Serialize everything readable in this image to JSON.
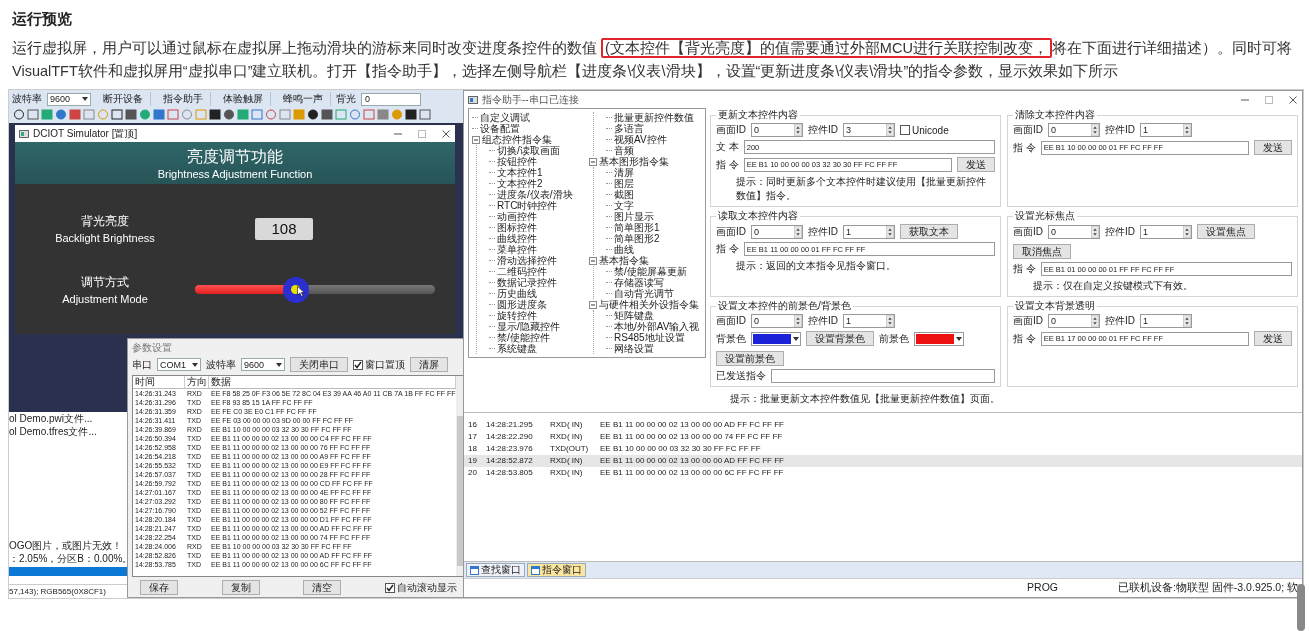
{
  "article": {
    "heading": "运行预览",
    "paragraph_parts": [
      {
        "text": "运行虚拟屏，用户可以通过鼠标在虚拟屏上拖动滑块的游标来同时改变进度条控件的数值 ",
        "highlighted": false
      },
      {
        "text": "(文本控件【背光亮度】的值需要通过外部MCU进行关联控制改变，",
        "highlighted": true
      },
      {
        "text": "将在下面进行详细描述）。同时可将VisualTFT软件和虚拟屏用“虚拟串口”建立联机。打开【指令助手】，选择左侧导航栏【进度条\\仪表\\滑块】，设置“更新进度条\\仪表\\滑块”的指令参数，显示效果如下所示",
        "highlighted": false
      }
    ]
  },
  "screenshot": {
    "toolbar": {
      "baud_label": "波特率",
      "baud_value": "9600",
      "buttons": [
        "断开设备",
        "指令助手",
        "体验触屏",
        "蜂鸣一声"
      ],
      "backlight_label": "背光",
      "backlight_value": "0"
    },
    "simulator": {
      "title": "DCIOT Simulator [置顶]",
      "heading": "亮度调节功能",
      "subheading": "Brightness Adjustment Function",
      "backlight": {
        "label_cn": "背光亮度",
        "label_en": "Backlight Brightness",
        "value": "108"
      },
      "adjust": {
        "label_cn": "调节方式",
        "label_en": "Adjustment Mode",
        "level": 0.42
      }
    },
    "background_window": {
      "lines": [
        "ol Demo.pwi文件...",
        "ol Demo.tfres文件..."
      ],
      "messages": [
        "OGO图片，或图片无效！",
        "：2.05%，分区B：0.00%。"
      ],
      "status": "57,143); RGB565(0X8CF1)"
    },
    "param_window": {
      "title": "参数设置",
      "port_label": "串口",
      "port": "COM1",
      "baud_label": "波特率",
      "baud": "9600",
      "close_button": "关闭串口",
      "topmost": {
        "label": "窗口置顶",
        "checked": true
      },
      "clear_button": "清屏",
      "columns": [
        "时间",
        "方向",
        "数据"
      ],
      "rows": [
        [
          "14:26:31.243",
          "RXD",
          "EE F8 58 25 0F F3 06 5E 72 8C 04 E3 39 AA 46 A0 11 CB 7A 1B FF FC FF FF"
        ],
        [
          "14:26:31.296",
          "TXD",
          "EE F8 93 85 15 1A FF FC FF FF"
        ],
        [
          "14:26:31.359",
          "RXD",
          "EE FE C0 3E E0 C1 FF FC FF FF"
        ],
        [
          "14:26:31.411",
          "TXD",
          "EE FE 03 00 00 00 03 9D 00 00 FF FC FF FF"
        ],
        [
          "14:26:39.869",
          "RXD",
          "EE B1 10 00 00 00 03 32 30 30 FF FC FF FF"
        ],
        [
          "14:26:50.394",
          "TXD",
          "EE B1 11 00 00 00 02 13 00 00 00 C4 FF FC FF FF"
        ],
        [
          "14:26:52.958",
          "TXD",
          "EE B1 11 00 00 00 02 13 00 00 00 76 FF FC FF FF"
        ],
        [
          "14:26:54.218",
          "TXD",
          "EE B1 11 00 00 00 02 13 00 00 00 A9 FF FC FF FF"
        ],
        [
          "14:26:55.532",
          "TXD",
          "EE B1 11 00 00 00 02 13 00 00 00 E9 FF FC FF FF"
        ],
        [
          "14:26:57.037",
          "TXD",
          "EE B1 11 00 00 00 02 13 00 00 00 28 FF FC FF FF"
        ],
        [
          "14:26:59.792",
          "TXD",
          "EE B1 11 00 00 00 02 13 00 00 00 CD FF FC FF FF"
        ],
        [
          "14:27:01.167",
          "TXD",
          "EE B1 11 00 00 00 02 13 00 00 00 4E FF FC FF FF"
        ],
        [
          "14:27:03.292",
          "TXD",
          "EE B1 11 00 00 00 02 13 00 00 00 80 FF FC FF FF"
        ],
        [
          "14:27:16.790",
          "TXD",
          "EE B1 11 00 00 00 02 13 00 00 00 52 FF FC FF FF"
        ],
        [
          "14:28:20.184",
          "TXD",
          "EE B1 11 00 00 00 02 13 00 00 00 D1 FF FC FF FF"
        ],
        [
          "14:28:21.247",
          "TXD",
          "EE B1 11 00 00 00 02 13 00 00 00 AD FF FC FF FF"
        ],
        [
          "14:28:22.254",
          "TXD",
          "EE B1 11 00 00 00 02 13 00 00 00 74 FF FC FF FF"
        ],
        [
          "14:28:24.006",
          "RXD",
          "EE B1 10 00 00 00 03 32 30 30 FF FC FF FF"
        ],
        [
          "14:28:52.826",
          "TXD",
          "EE B1 11 00 00 00 02 13 00 00 00 AD FF FC FF FF"
        ],
        [
          "14:28:53.785",
          "TXD",
          "EE B1 11 00 00 00 02 13 00 00 00 6C FF FC FF FF"
        ]
      ],
      "bottom_buttons": [
        "保存",
        "复制",
        "清空"
      ],
      "autoscroll": {
        "label": "自动滚动显示",
        "checked": true
      }
    },
    "assistant": {
      "title": "指令助手--串口已连接",
      "tree": [
        {
          "label": "自定义调试"
        },
        {
          "label": "设备配置"
        },
        {
          "label": "组态控件指令集",
          "expanded": true,
          "children": [
            {
              "label": "切换/读取画面"
            },
            {
              "label": "按钮控件"
            },
            {
              "label": "文本控件1"
            },
            {
              "label": "文本控件2"
            },
            {
              "label": "进度条/仪表/滑块"
            },
            {
              "label": "RTC时钟控件"
            },
            {
              "label": "动画控件"
            },
            {
              "label": "图标控件"
            },
            {
              "label": "曲线控件"
            },
            {
              "label": "菜单控件"
            },
            {
              "label": "滑动选择控件"
            },
            {
              "label": "二维码控件"
            },
            {
              "label": "数据记录控件"
            },
            {
              "label": "历史曲线"
            },
            {
              "label": "圆形进度条"
            },
            {
              "label": "旋转控件"
            },
            {
              "label": "显示/隐藏控件"
            },
            {
              "label": "禁/使能控件"
            },
            {
              "label": "系统键盘"
            },
            {
              "label": "批量更新控件数值"
            },
            {
              "label": "多语言"
            },
            {
              "label": "视频AV控件"
            },
            {
              "label": "音频"
            }
          ]
        },
        {
          "label": "基本图形指令集",
          "expanded": true,
          "children": [
            {
              "label": "清屏"
            },
            {
              "label": "图层"
            },
            {
              "label": "截图"
            },
            {
              "label": "文字"
            },
            {
              "label": "图片显示"
            },
            {
              "label": "简单图形1"
            },
            {
              "label": "简单图形2"
            },
            {
              "label": "曲线"
            }
          ]
        },
        {
          "label": "基本指令集",
          "expanded": true,
          "children": [
            {
              "label": "禁/使能屏幕更新"
            },
            {
              "label": "存储器读写"
            },
            {
              "label": "自动背光调节"
            }
          ]
        },
        {
          "label": "与硬件相关外设指令集",
          "expanded": true,
          "children": [
            {
              "label": "矩阵键盘"
            },
            {
              "label": "本地/外部AV输入视"
            },
            {
              "label": "RS485地址设置"
            },
            {
              "label": "网络设置"
            }
          ]
        }
      ],
      "groups": [
        {
          "title": "更新文本控件内容",
          "lines": [
            {
              "items": [
                {
                  "kind": "spin",
                  "label": "画面ID",
                  "value": "0"
                },
                {
                  "kind": "spin",
                  "label": "控件ID",
                  "value": "3"
                },
                {
                  "kind": "checkbox",
                  "label": "Unicode",
                  "checked": false
                }
              ]
            },
            {
              "items": [
                {
                  "kind": "field",
                  "label": "文 本",
                  "value": "200"
                }
              ]
            },
            {
              "items": [
                {
                  "kind": "field",
                  "label": "指 令",
                  "value": "EE B1 10 00 00 00 03 32 30 30 FF FC FF FF"
                },
                {
                  "kind": "button",
                  "label": "发送"
                }
              ]
            },
            {
              "items": [
                {
                  "kind": "hint",
                  "text": "提示：同时更新多个文本控件时建议使用【批量更新控件数值】指令。"
                }
              ]
            }
          ]
        },
        {
          "title": "清除文本控件内容",
          "lines": [
            {
              "items": [
                {
                  "kind": "spin",
                  "label": "画面ID",
                  "value": "0"
                },
                {
                  "kind": "spin",
                  "label": "控件ID",
                  "value": "1"
                }
              ]
            },
            {
              "items": [
                {
                  "kind": "field",
                  "label": "指 令",
                  "value": "EE B1 10 00 00 00 01 FF FC FF FF"
                },
                {
                  "kind": "button",
                  "label": "发送"
                }
              ]
            }
          ]
        },
        {
          "title": "读取文本控件内容",
          "lines": [
            {
              "items": [
                {
                  "kind": "spin",
                  "label": "画面ID",
                  "value": "0"
                },
                {
                  "kind": "spin",
                  "label": "控件ID",
                  "value": "1"
                },
                {
                  "kind": "button",
                  "label": "获取文本"
                }
              ]
            },
            {
              "items": [
                {
                  "kind": "field",
                  "label": "指 令",
                  "value": "EE B1 11 00 00 00 01 FF FC FF FF"
                }
              ]
            },
            {
              "items": [
                {
                  "kind": "hint",
                  "text": "提示：返回的文本指令见指令窗口。"
                }
              ]
            }
          ]
        },
        {
          "title": "设置光标焦点",
          "lines": [
            {
              "items": [
                {
                  "kind": "spin",
                  "label": "画面ID",
                  "value": "0"
                },
                {
                  "kind": "spin",
                  "label": "控件ID",
                  "value": "1"
                },
                {
                  "kind": "button",
                  "label": "设置焦点"
                },
                {
                  "kind": "button",
                  "label": "取消焦点"
                }
              ]
            },
            {
              "items": [
                {
                  "kind": "field",
                  "label": "指 令",
                  "value": "EE B1 01 00 00 00 01 FF FF FC FF FF"
                }
              ]
            },
            {
              "items": [
                {
                  "kind": "hint",
                  "text": "提示：仅在自定义按键模式下有效。"
                }
              ]
            }
          ]
        },
        {
          "title": "设置文本控件的前景色/背景色",
          "lines": [
            {
              "items": [
                {
                  "kind": "spin",
                  "label": "画面ID",
                  "value": "0"
                },
                {
                  "kind": "spin",
                  "label": "控件ID",
                  "value": "1"
                }
              ]
            },
            {
              "items": [
                {
                  "kind": "color",
                  "label": "背景色",
                  "color": "#1c22d8"
                },
                {
                  "kind": "button",
                  "label": "设置背景色"
                },
                {
                  "kind": "color",
                  "label": "前景色",
                  "color": "#ee1111"
                },
                {
                  "kind": "button",
                  "label": "设置前景色"
                }
              ]
            },
            {
              "items": [
                {
                  "kind": "field",
                  "label": "已发送指令"
                }
              ]
            }
          ]
        },
        {
          "title": "设置文本背景透明",
          "lines": [
            {
              "items": [
                {
                  "kind": "spin",
                  "label": "画面ID",
                  "value": "0"
                },
                {
                  "kind": "spin",
                  "label": "控件ID",
                  "value": "1"
                }
              ]
            },
            {
              "items": [
                {
                  "kind": "field",
                  "label": "指 令",
                  "value": "EE B1 17 00 00 00 01 FF FC FF FF"
                },
                {
                  "kind": "button",
                  "label": "发送"
                }
              ]
            }
          ]
        }
      ],
      "footer_hint": "提示：批量更新文本控件数值见【批量更新控件数值】页面。",
      "log": [
        {
          "index": "16",
          "time": "14:28:21.295",
          "direction": "RXD( IN)",
          "data": "EE B1 11 00 00 00 02 13 00 00 00 AD FF FC FF FF",
          "selected": false
        },
        {
          "index": "17",
          "time": "14:28:22.290",
          "direction": "RXD( IN)",
          "data": "EE B1 11 00 00 00 02 13 00 00 00 74 FF FC FF FF",
          "selected": false
        },
        {
          "index": "18",
          "time": "14:28:23.976",
          "direction": "TXD(OUT)",
          "data": "EE B1 10 00 00 00 03 32 30 30 FF FC FF FF",
          "selected": false
        },
        {
          "index": "19",
          "time": "14:28:52.872",
          "direction": "RXD( IN)",
          "data": "EE B1 11 00 00 00 02 13 00 00 00 AD FF FC FF FF",
          "selected": true
        },
        {
          "index": "20",
          "time": "14:28:53.805",
          "direction": "RXD( IN)",
          "data": "EE B1 11 00 00 00 02 13 00 00 00 6C FF FC FF FF",
          "selected": false
        }
      ],
      "tabs": [
        {
          "label": "查找窗口",
          "selected": false
        },
        {
          "label": "指令窗口",
          "selected": true
        }
      ],
      "status": {
        "mode": "PROG",
        "device": "已联机设备:物联型 固件-3.0.925.0; 软"
      }
    }
  }
}
